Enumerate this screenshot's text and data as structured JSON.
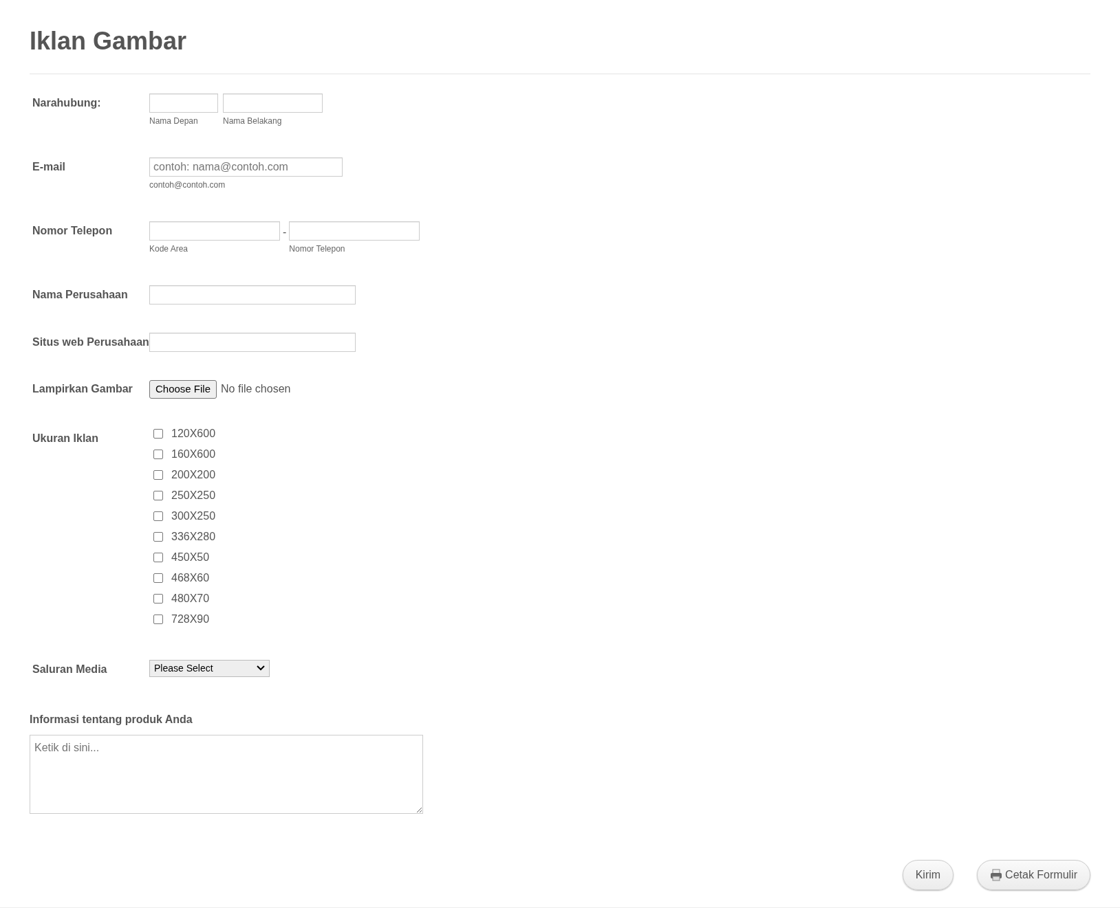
{
  "title": "Iklan Gambar",
  "fields": [
    {
      "kind": "name",
      "label": "Narahubung:",
      "inputs": [
        {
          "sublabel": "Nama Depan"
        },
        {
          "sublabel": "Nama Belakang"
        }
      ]
    },
    {
      "kind": "email",
      "label": "E-mail",
      "placeholder": "contoh: nama@contoh.com",
      "sublabel": "contoh@contoh.com"
    },
    {
      "kind": "phone",
      "label": "Nomor Telepon",
      "separator": "-",
      "inputs": [
        {
          "sublabel": "Kode Area"
        },
        {
          "sublabel": "Nomor Telepon"
        }
      ]
    },
    {
      "kind": "text",
      "label": "Nama Perusahaan"
    },
    {
      "kind": "text",
      "label": "Situs web Perusahaan"
    },
    {
      "kind": "file",
      "label": "Lampirkan Gambar",
      "button": "Choose File",
      "status": "No file chosen"
    },
    {
      "kind": "checkboxes",
      "label": "Ukuran Iklan",
      "options": [
        {
          "label": "120X600",
          "checked": false
        },
        {
          "label": "160X600",
          "checked": false
        },
        {
          "label": "200X200",
          "checked": false
        },
        {
          "label": "250X250",
          "checked": false
        },
        {
          "label": "300X250",
          "checked": false
        },
        {
          "label": "336X280",
          "checked": false
        },
        {
          "label": "450X50",
          "checked": false
        },
        {
          "label": "468X60",
          "checked": false
        },
        {
          "label": "480X70",
          "checked": false
        },
        {
          "label": "728X90",
          "checked": false
        }
      ]
    },
    {
      "kind": "select",
      "label": "Saluran Media",
      "value": "Please Select"
    },
    {
      "kind": "textarea",
      "label": "Informasi tentang produk Anda",
      "placeholder": "Ketik di sini..."
    }
  ],
  "buttons": [
    {
      "kind": "submit",
      "label": "Kirim"
    },
    {
      "kind": "print",
      "label": "Cetak Formulir"
    }
  ]
}
